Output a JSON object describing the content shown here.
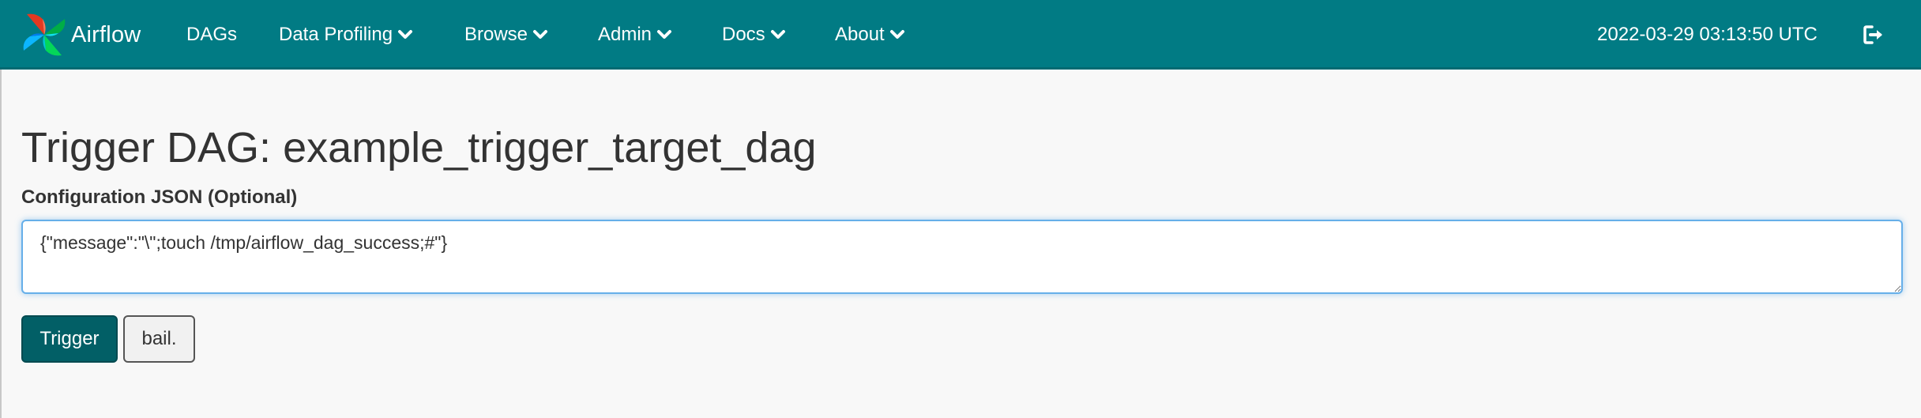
{
  "navbar": {
    "brand": "Airflow",
    "brand_logo_icon": "airflow-pinwheel-icon",
    "items": [
      {
        "label": "DAGs",
        "dropdown": false
      },
      {
        "label": "Data Profiling",
        "dropdown": true
      },
      {
        "label": "Browse",
        "dropdown": true
      },
      {
        "label": "Admin",
        "dropdown": true
      },
      {
        "label": "Docs",
        "dropdown": true
      },
      {
        "label": "About",
        "dropdown": true
      }
    ],
    "clock": "2022-03-29 03:13:50 UTC",
    "logout_icon": "sign-out-icon",
    "bg_color": "#017b84"
  },
  "page": {
    "title": "Trigger DAG: example_trigger_target_dag",
    "conf_label": "Configuration JSON (Optional)",
    "conf_value": "{\"message\":\"\\\";touch /tmp/airflow_dag_success;#\"}",
    "trigger_label": "Trigger",
    "bail_label": "bail."
  },
  "colors": {
    "primary": "#025f66",
    "focus": "#66afe9"
  }
}
